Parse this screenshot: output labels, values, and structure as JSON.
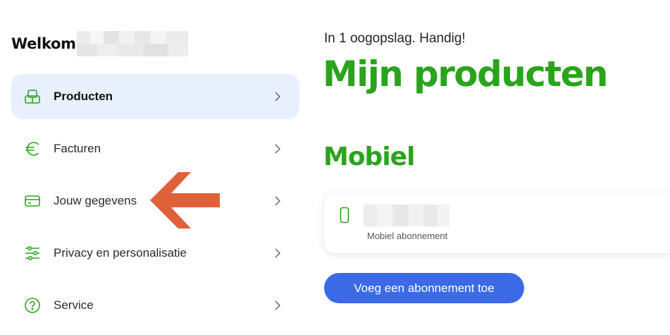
{
  "welcome": {
    "text": "Welkom"
  },
  "nav": {
    "items": [
      {
        "label": "Producten",
        "icon": "products-icon",
        "active": true
      },
      {
        "label": "Facturen",
        "icon": "euro-icon",
        "active": false
      },
      {
        "label": "Jouw gegevens",
        "icon": "card-icon",
        "active": false
      },
      {
        "label": "Privacy en personalisatie",
        "icon": "sliders-icon",
        "active": false
      },
      {
        "label": "Service",
        "icon": "help-icon",
        "active": false
      }
    ]
  },
  "main": {
    "tagline": "In 1 oogopslag. Handig!",
    "title": "Mijn producten",
    "section_title": "Mobiel",
    "card": {
      "icon": "phone-icon",
      "subtitle": "Mobiel abonnement"
    },
    "add_button_label": "Voeg een abonnement toe"
  },
  "colors": {
    "brand_green": "#2aa41c",
    "accent_blue": "#3a6ae6",
    "active_bg": "#e7f0fc",
    "arrow": "#e0603a"
  }
}
